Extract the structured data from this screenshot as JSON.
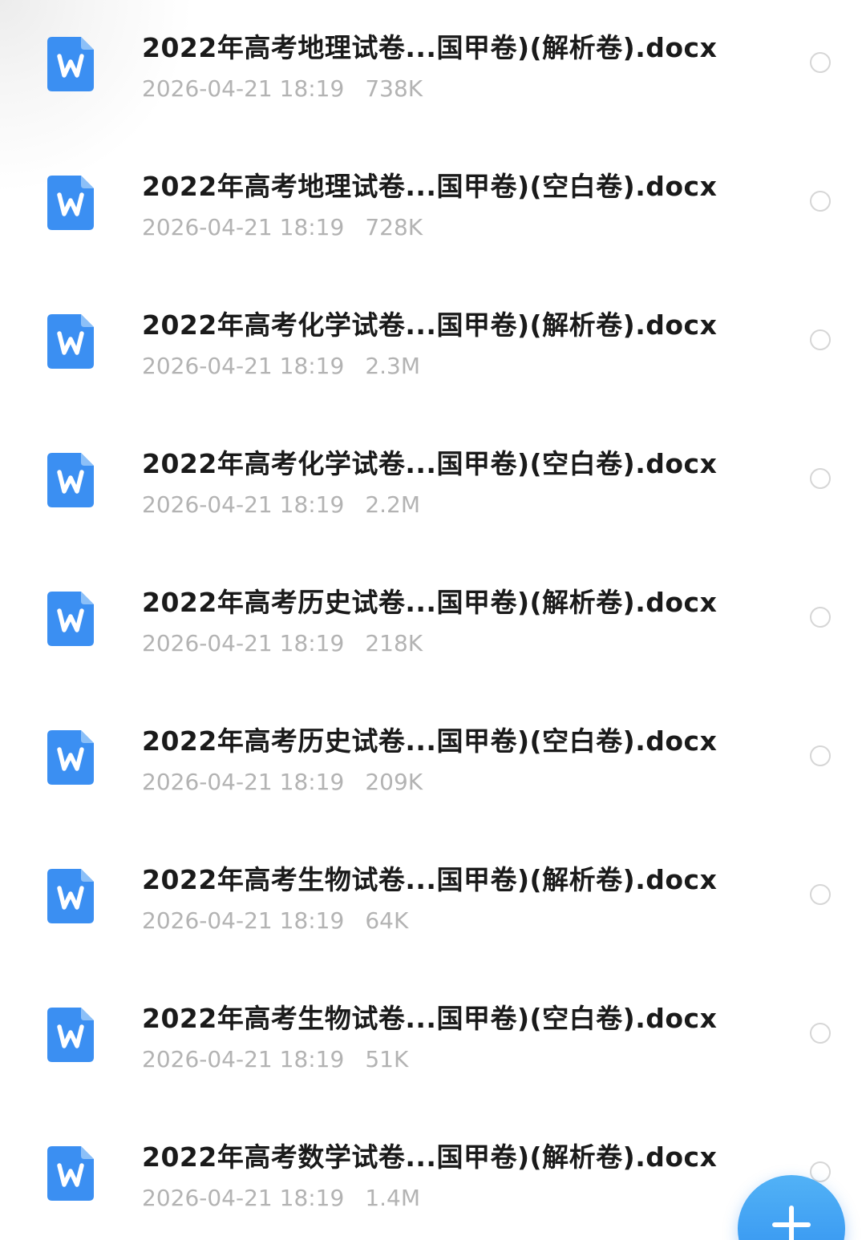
{
  "files": [
    {
      "name": "2022年高考地理试卷...国甲卷)(解析卷).docx",
      "date": "2026-04-21 18:19",
      "size": "738K",
      "icon": "word-doc-icon"
    },
    {
      "name": "2022年高考地理试卷...国甲卷)(空白卷).docx",
      "date": "2026-04-21 18:19",
      "size": "728K",
      "icon": "word-doc-icon"
    },
    {
      "name": "2022年高考化学试卷...国甲卷)(解析卷).docx",
      "date": "2026-04-21 18:19",
      "size": "2.3M",
      "icon": "word-doc-icon"
    },
    {
      "name": "2022年高考化学试卷...国甲卷)(空白卷).docx",
      "date": "2026-04-21 18:19",
      "size": "2.2M",
      "icon": "word-doc-icon"
    },
    {
      "name": "2022年高考历史试卷...国甲卷)(解析卷).docx",
      "date": "2026-04-21 18:19",
      "size": "218K",
      "icon": "word-doc-icon"
    },
    {
      "name": "2022年高考历史试卷...国甲卷)(空白卷).docx",
      "date": "2026-04-21 18:19",
      "size": "209K",
      "icon": "word-doc-icon"
    },
    {
      "name": "2022年高考生物试卷...国甲卷)(解析卷).docx",
      "date": "2026-04-21 18:19",
      "size": "64K",
      "icon": "word-doc-icon"
    },
    {
      "name": "2022年高考生物试卷...国甲卷)(空白卷).docx",
      "date": "2026-04-21 18:19",
      "size": "51K",
      "icon": "word-doc-icon"
    },
    {
      "name": "2022年高考数学试卷...国甲卷)(解析卷).docx",
      "date": "2026-04-21 18:19",
      "size": "1.4M",
      "icon": "word-doc-icon"
    }
  ],
  "fab": {
    "icon": "plus-icon"
  },
  "colors": {
    "accent": "#3b8ff2",
    "title_text": "#1a1a1a",
    "meta_text": "#b3b3b3",
    "radio_border": "#d6d6d6"
  }
}
